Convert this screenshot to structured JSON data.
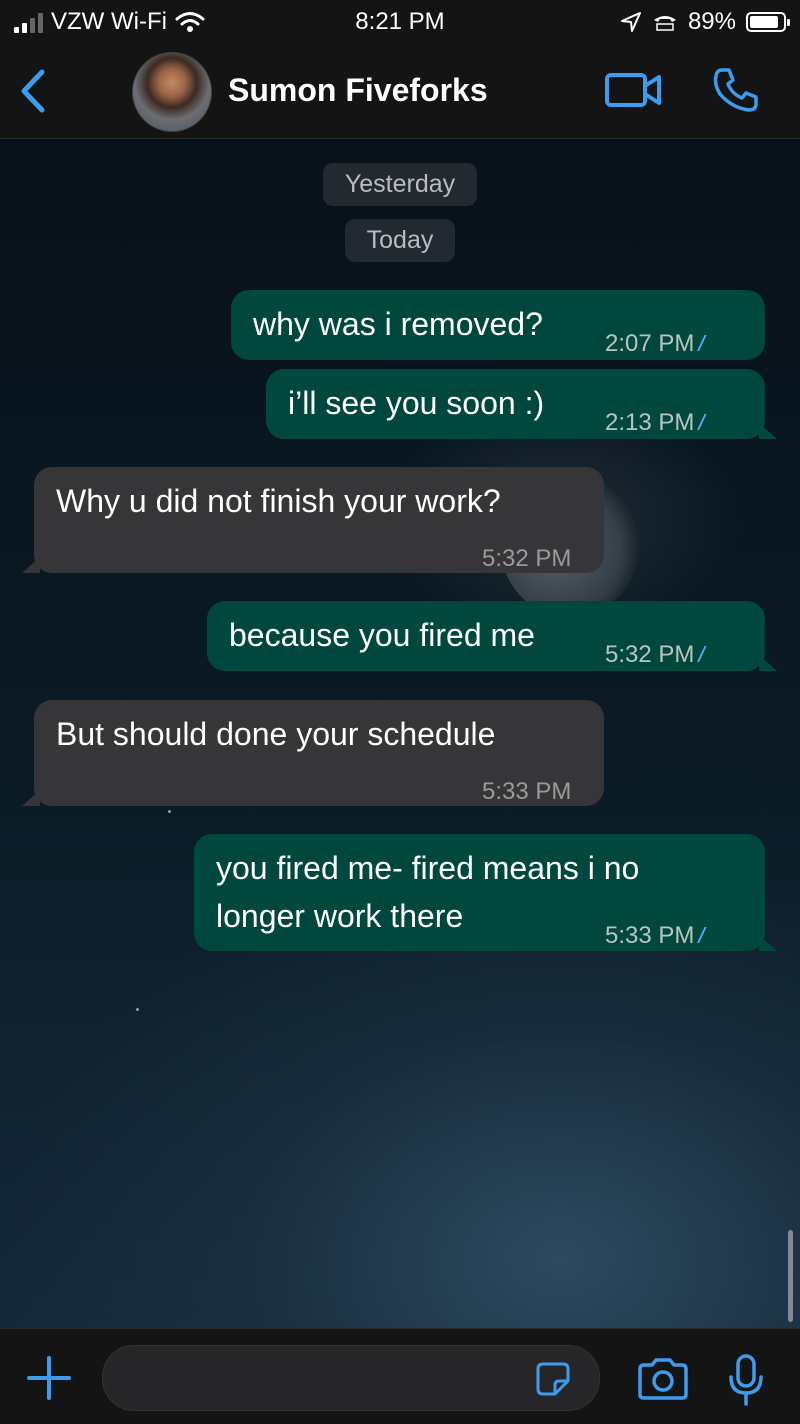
{
  "status_bar": {
    "carrier": "VZW Wi-Fi",
    "time": "8:21 PM",
    "battery": "89%",
    "battery_level": 0.89
  },
  "header": {
    "contact_name": "Sumon Fiveforks"
  },
  "date_separators": [
    "Yesterday",
    "Today"
  ],
  "messages": [
    {
      "direction": "outgoing",
      "text": "why was i removed?",
      "time": "2:07 PM",
      "read": true
    },
    {
      "direction": "outgoing",
      "text": "i’ll see you soon :)",
      "time": "2:13 PM",
      "read": true
    },
    {
      "direction": "incoming",
      "text": "Why u did not finish your work?",
      "time": "5:32 PM"
    },
    {
      "direction": "outgoing",
      "text": "because you fired me",
      "time": "5:32 PM",
      "read": true
    },
    {
      "direction": "incoming",
      "text": "But should done your schedule",
      "time": "5:33 PM"
    },
    {
      "direction": "outgoing",
      "text_lines": [
        "you fired me- fired means i no",
        "longer work there"
      ],
      "time": "5:33 PM",
      "read": true
    }
  ],
  "colors": {
    "accent": "#3c9cf0",
    "outgoing_bubble": "#00473d",
    "incoming_bubble": "#363638",
    "read_tick": "#4fb3ff"
  },
  "icons": {
    "back": "chevron-left-icon",
    "video": "video-camera-icon",
    "call": "phone-icon",
    "attach": "plus-icon",
    "sticker": "sticker-icon",
    "camera": "camera-icon",
    "mic": "microphone-icon"
  }
}
